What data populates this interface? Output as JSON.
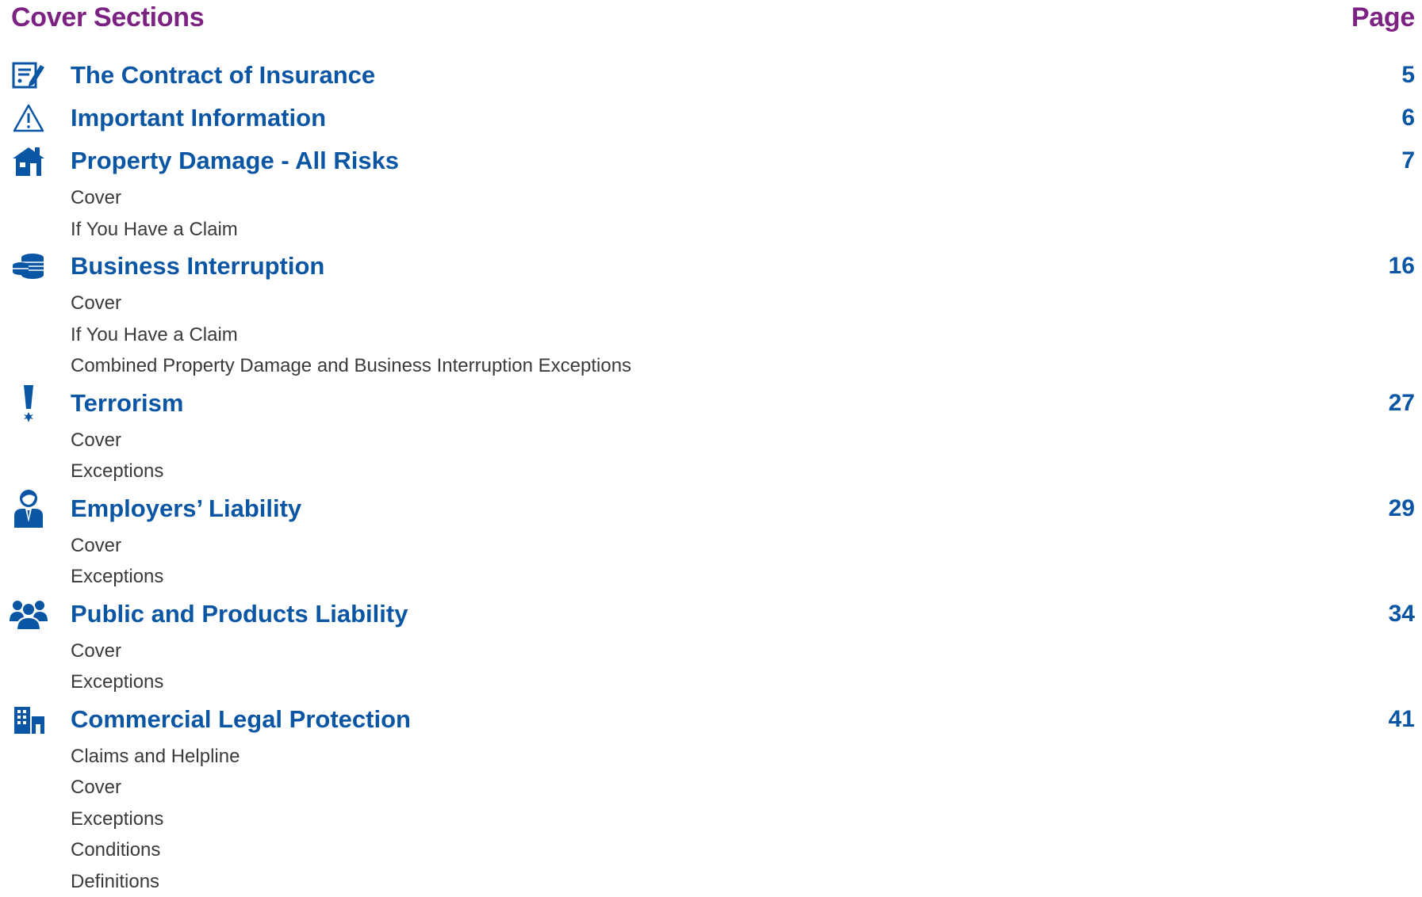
{
  "header": {
    "title": "Cover Sections",
    "page_label": "Page"
  },
  "sections": [
    {
      "icon": "document-edit-icon",
      "title": "The Contract of Insurance",
      "page": "5",
      "subs": []
    },
    {
      "icon": "warning-triangle-icon",
      "title": "Important Information",
      "page": "6",
      "subs": []
    },
    {
      "icon": "house-icon",
      "title": "Property Damage - All Risks",
      "page": "7",
      "subs": [
        "Cover",
        "If You Have a Claim"
      ]
    },
    {
      "icon": "coins-icon",
      "title": "Business Interruption",
      "page": "16",
      "subs": [
        "Cover",
        "If You Have a Claim",
        "Combined Property Damage and Business Interruption Exceptions"
      ]
    },
    {
      "icon": "explosion-exclamation-icon",
      "title": "Terrorism",
      "page": "27",
      "subs": [
        "Cover",
        "Exceptions"
      ]
    },
    {
      "icon": "employee-icon",
      "title": "Employers’ Liability",
      "page": "29",
      "subs": [
        "Cover",
        "Exceptions"
      ]
    },
    {
      "icon": "people-group-icon",
      "title": "Public and Products Liability",
      "page": "34",
      "subs": [
        "Cover",
        "Exceptions"
      ]
    },
    {
      "icon": "office-building-icon",
      "title": "Commercial Legal Protection",
      "page": "41",
      "subs": [
        "Claims and Helpline",
        "Cover",
        "Exceptions",
        "Conditions",
        "Definitions"
      ]
    }
  ],
  "colors": {
    "heading": "#7b2282",
    "section": "#0a56a4",
    "sub": "#3a3a3a"
  }
}
